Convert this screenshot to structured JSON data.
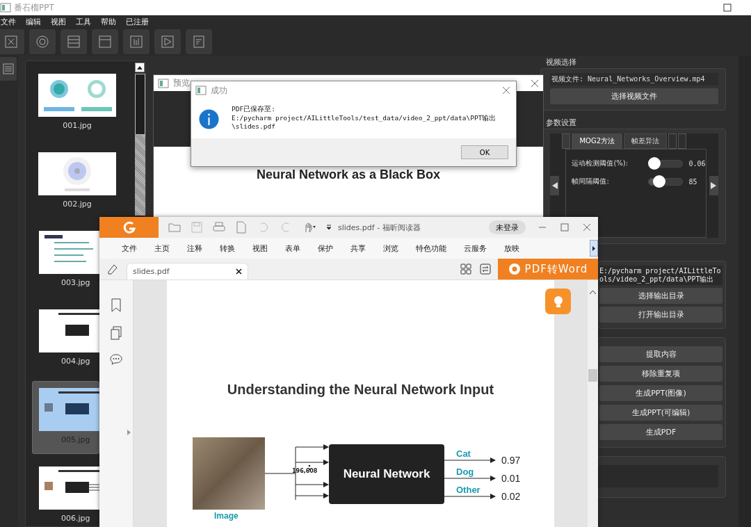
{
  "window": {
    "title": "番石榴PPT"
  },
  "menu": [
    "文件",
    "编辑",
    "视图",
    "工具",
    "帮助",
    "已注册"
  ],
  "thumbnails": [
    {
      "label": "001.jpg",
      "selected": false
    },
    {
      "label": "002.jpg",
      "selected": false
    },
    {
      "label": "003.jpg",
      "selected": false
    },
    {
      "label": "004.jpg",
      "selected": false
    },
    {
      "label": "005.jpg",
      "selected": true
    },
    {
      "label": "006.jpg",
      "selected": false
    }
  ],
  "preview": {
    "title": "预览",
    "heading": "Neural Network as a Black Box"
  },
  "video_selection": {
    "title": "视频选择",
    "file": "视频文件: Neural_Networks_Overview.mp4",
    "button": "选择视频文件"
  },
  "parameters": {
    "title": "参数设置",
    "tabs": [
      {
        "label": "MOG2方法",
        "selected": true
      },
      {
        "label": "帧差异法",
        "selected": false
      }
    ],
    "sliders": [
      {
        "label": "运动检测阈值(%):",
        "level": 0.05,
        "reading": "0.06"
      },
      {
        "label": "帧间隔阈值:",
        "level": 0.2,
        "reading": "85"
      }
    ]
  },
  "output": {
    "path": "E:/pycharm project/AILittleTools/video_2_ppt/data\\PPT输出",
    "buttons": [
      "选择输出目录",
      "打开输出目录"
    ]
  },
  "actions": [
    "提取内容",
    "移除重复项",
    "生成PPT(图像)",
    "生成PPT(可编辑)",
    "生成PDF"
  ],
  "dialog": {
    "title": "成功",
    "message": "PDF已保存至:\nE:/pycharm project/AILittleTools/test_data/video_2_ppt/data\\PPT输出\n\\slides.pdf",
    "button": "OK"
  },
  "reader": {
    "title": "slides.pdf - 福昕阅读器",
    "login": "未登录",
    "menu": [
      "文件",
      "主页",
      "注释",
      "转换",
      "视图",
      "表单",
      "保护",
      "共享",
      "浏览",
      "特色功能",
      "云服务",
      "放映"
    ],
    "tab": "slides.pdf",
    "convert_button": "PDF转Word",
    "page": {
      "heading": "Understanding the Neural Network Input",
      "image_label": "Image",
      "dimension": "196,608",
      "network": "Neural Network",
      "outputs": [
        {
          "label": "Cat",
          "value": "0.97"
        },
        {
          "label": "Dog",
          "value": "0.01"
        },
        {
          "label": "Other",
          "value": "0.02"
        }
      ]
    }
  }
}
